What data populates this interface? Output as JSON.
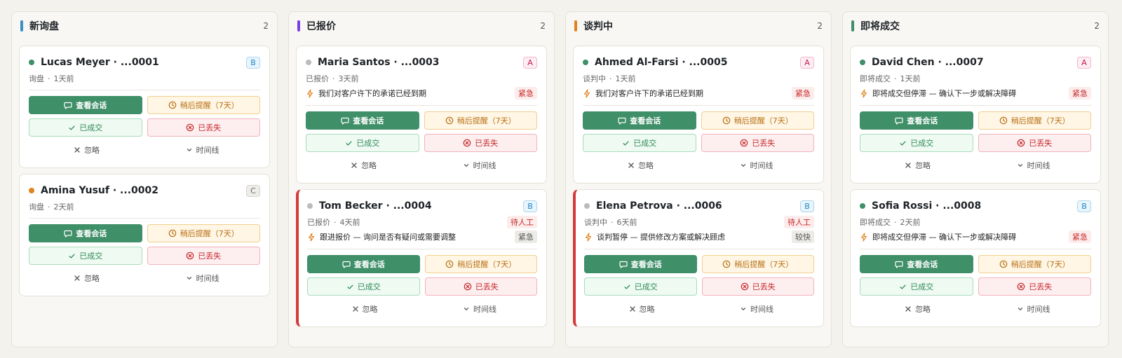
{
  "columns": [
    {
      "title": "新询盘",
      "count": "2",
      "color": "#3b8fc4",
      "cards": [
        {
          "name": "Lucas Meyer · ...0001",
          "dot": "#3f8f68",
          "grade": "B",
          "stage": "询盘",
          "time": "1天前",
          "human": "",
          "reason": "",
          "urgency": "",
          "flag": false
        },
        {
          "name": "Amina Yusuf · ...0002",
          "dot": "#e0821e",
          "grade": "C",
          "stage": "询盘",
          "time": "2天前",
          "human": "",
          "reason": "",
          "urgency": "",
          "flag": false
        }
      ]
    },
    {
      "title": "已报价",
      "count": "2",
      "color": "#7b3fe4",
      "cards": [
        {
          "name": "Maria Santos · ...0003",
          "dot": "#bbbbbb",
          "grade": "A",
          "stage": "已报价",
          "time": "3天前",
          "human": "",
          "reason": "我们对客户许下的承诺已经到期",
          "urgency": "紧急",
          "urgency_style": "red",
          "flag": false
        },
        {
          "name": "Tom Becker · ...0004",
          "dot": "#bbbbbb",
          "grade": "B",
          "stage": "已报价",
          "time": "4天前",
          "human": "待人工",
          "reason": "跟进报价 — 询问是否有疑问或需要调整",
          "urgency": "紧急",
          "urgency_style": "grey",
          "flag": true
        }
      ]
    },
    {
      "title": "谈判中",
      "count": "2",
      "color": "#e0821e",
      "cards": [
        {
          "name": "Ahmed Al-Farsi · ...0005",
          "dot": "#3f8f68",
          "grade": "A",
          "stage": "谈判中",
          "time": "1天前",
          "human": "",
          "reason": "我们对客户许下的承诺已经到期",
          "urgency": "紧急",
          "urgency_style": "red",
          "flag": false
        },
        {
          "name": "Elena Petrova · ...0006",
          "dot": "#bbbbbb",
          "grade": "B",
          "stage": "谈判中",
          "time": "6天前",
          "human": "待人工",
          "reason": "谈判暂停 — 提供修改方案或解决顾虑",
          "urgency": "较快",
          "urgency_style": "grey",
          "flag": true
        }
      ]
    },
    {
      "title": "即将成交",
      "count": "2",
      "color": "#3f8f68",
      "cards": [
        {
          "name": "David Chen · ...0007",
          "dot": "#3f8f68",
          "grade": "A",
          "stage": "即将成交",
          "time": "1天前",
          "human": "",
          "reason": "即将成交但停滞 — 确认下一步或解决障碍",
          "urgency": "紧急",
          "urgency_style": "red",
          "flag": false
        },
        {
          "name": "Sofia Rossi · ...0008",
          "dot": "#3f8f68",
          "grade": "B",
          "stage": "即将成交",
          "time": "2天前",
          "human": "",
          "reason": "即将成交但停滞 — 确认下一步或解决障碍",
          "urgency": "紧急",
          "urgency_style": "red",
          "flag": false
        }
      ]
    }
  ],
  "actions": {
    "view_chat": "查看会话",
    "remind_later": "稍后提醒（7天）",
    "won": "已成交",
    "lost": "已丢失",
    "ignore": "忽略",
    "timeline": "时间线"
  }
}
